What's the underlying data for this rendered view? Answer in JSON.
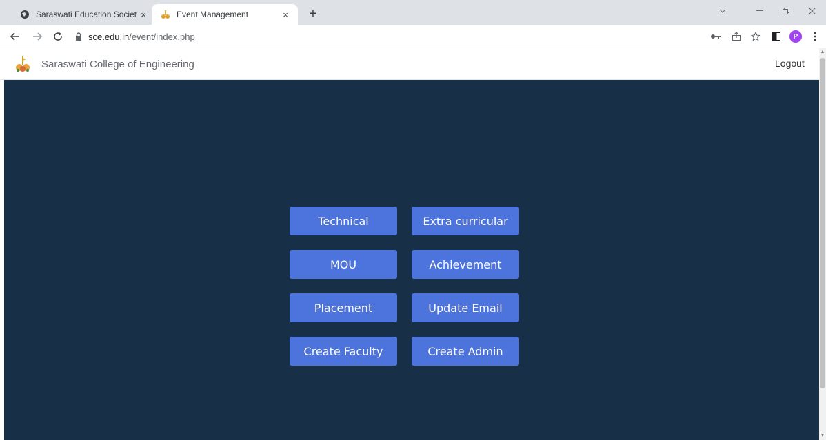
{
  "browser": {
    "tabs": [
      {
        "title": "Saraswati Education Society",
        "icon": "globe-icon",
        "active": false
      },
      {
        "title": "Event Management",
        "icon": "college-logo-icon",
        "active": true
      }
    ],
    "new_tab_glyph": "+",
    "close_glyph": "×",
    "url_host": "sce.edu.in",
    "url_path": "/event/index.php",
    "profile_initial": "P"
  },
  "site": {
    "brand_name": "Saraswati College of Engineering",
    "logout_label": "Logout"
  },
  "menu": {
    "technical": "Technical",
    "extra_curricular": "Extra curricular",
    "mou": "MOU",
    "achievement": "Achievement",
    "placement": "Placement",
    "update_email": "Update Email",
    "create_faculty": "Create Faculty",
    "create_admin": "Create Admin"
  },
  "colors": {
    "hero_background": "#183047",
    "button": "#4d73dd",
    "tabstrip": "#dee1e6",
    "profile": "#a142f4"
  }
}
